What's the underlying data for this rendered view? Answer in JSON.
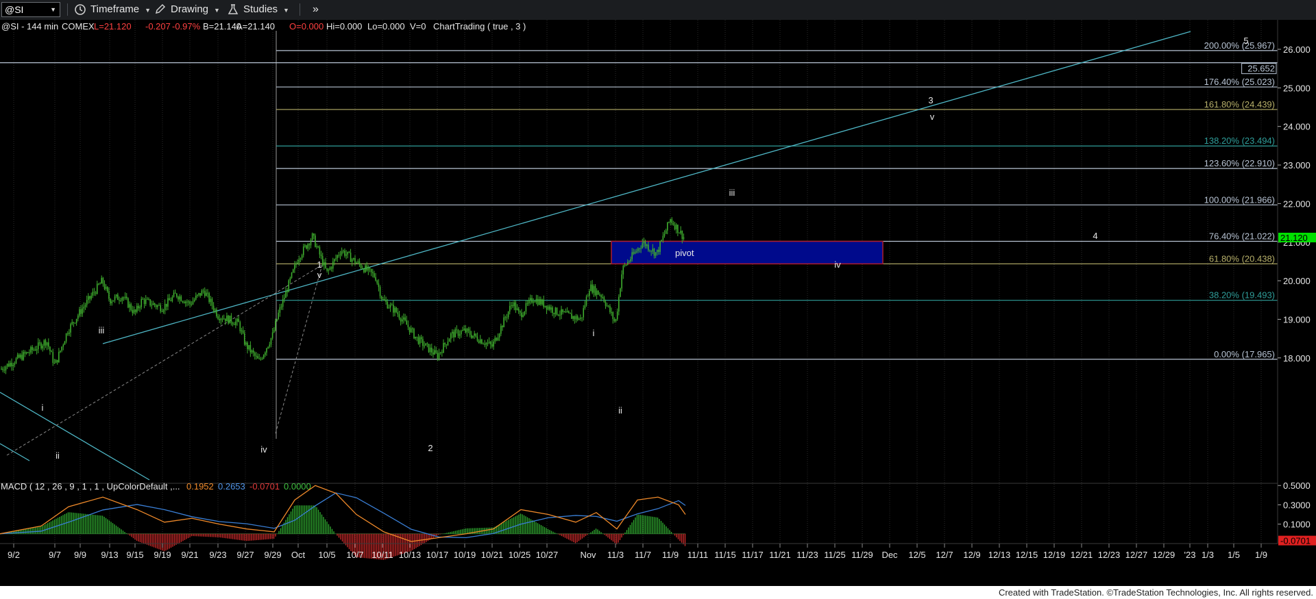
{
  "toolbar": {
    "symbol": "@SI",
    "timeframe_label": "Timeframe",
    "drawing_label": "Drawing",
    "studies_label": "Studies",
    "more_label": "»"
  },
  "info_line": {
    "symbol": "@SI - 144 min",
    "exchange": "COMEX",
    "last": "L=21.120",
    "change": "-0.207",
    "change_pct": "-0.97%",
    "bid": "B=21.140",
    "ask": "A=21.140",
    "open": "O=0.000",
    "hi": "Hi=0.000",
    "lo": "Lo=0.000",
    "volume": "V=0",
    "study": "ChartTrading ( true , 3 )"
  },
  "macd_line": {
    "label": "MACD ( 12 , 26 , 9 , 1 , 1 , UpColorDefault ,...",
    "macd": "0.1952",
    "signal": "0.2653",
    "diff": "-0.0701",
    "zero": "0.0000"
  },
  "footer": {
    "text": "Created with TradeStation. ©TradeStation Technologies, Inc. All rights reserved."
  },
  "colors": {
    "background": "#000000",
    "candle": "#3fae2e",
    "trendline": "#4fb8c7",
    "pivot_fill": "#000a8c",
    "pivot_border": "#b01c2c",
    "last_price": "#00e000",
    "macd_line": "#f08a2a",
    "signal_line": "#3a7fd6",
    "hist_pos": "#2fa62f",
    "hist_neg": "#c82a2a",
    "macd_neg_label": "#e02020"
  },
  "chart_data": {
    "type": "candlestick",
    "instrument": "@SI",
    "interval": "144 min",
    "ylim": [
      17.4,
      26.8
    ],
    "price_axis_ticks": [
      "26.000",
      "25.000",
      "24.000",
      "23.000",
      "22.000",
      "21.000",
      "20.000",
      "19.000",
      "18.000"
    ],
    "last_price": "21.120",
    "date_labels": [
      "9/2",
      "9/7",
      "9/9",
      "9/13",
      "9/15",
      "9/19",
      "9/21",
      "9/23",
      "9/27",
      "9/29",
      "Oct",
      "10/5",
      "10/7",
      "10/11",
      "10/13",
      "10/17",
      "10/19",
      "10/21",
      "10/25",
      "10/27",
      "Nov",
      "11/3",
      "11/7",
      "11/9",
      "11/11",
      "11/15",
      "11/17",
      "11/21",
      "11/23",
      "11/25",
      "11/29",
      "Dec",
      "12/5",
      "12/7",
      "12/9",
      "12/13",
      "12/15",
      "12/19",
      "12/21",
      "12/23",
      "12/27",
      "12/29",
      "'23",
      "1/3",
      "1/5",
      "1/9"
    ],
    "fib_levels": [
      {
        "label": "200.00% (25.967)",
        "price": 25.967,
        "color": "#b8c4d4"
      },
      {
        "label": "25.652",
        "price": 25.652,
        "color": "#b8c4d4",
        "boxed": true
      },
      {
        "label": "176.40% (25.023)",
        "price": 25.023,
        "color": "#b8c4d4"
      },
      {
        "label": "161.80% (24.439)",
        "price": 24.439,
        "color": "#b7b06a"
      },
      {
        "label": "138.20% (23.494)",
        "price": 23.494,
        "color": "#2f9e9a"
      },
      {
        "label": "123.60% (22.910)",
        "price": 22.91,
        "color": "#b8c4d4"
      },
      {
        "label": "100.00% (21.966)",
        "price": 21.966,
        "color": "#b8c4d4"
      },
      {
        "label": "76.40% (21.022)",
        "price": 21.022,
        "color": "#b8c4d4"
      },
      {
        "label": "61.80% (20.438)",
        "price": 20.438,
        "color": "#b7b06a"
      },
      {
        "label": "38.20% (19.493)",
        "price": 19.493,
        "color": "#2f9e9a"
      },
      {
        "label": "0.00% (17.965)",
        "price": 17.965,
        "color": "#b8c4d4"
      }
    ],
    "pivot_zone": {
      "label": "pivot",
      "low": 20.438,
      "high": 21.022
    },
    "wave_labels": [
      "5",
      "3",
      "v",
      "iii",
      "4",
      "iv",
      "1",
      "v",
      "iii",
      "i",
      "ii",
      "iv",
      "2",
      "i",
      "ii"
    ],
    "price_path": [
      {
        "d": "9/1",
        "p": 17.7
      },
      {
        "d": "9/5",
        "p": 18.3
      },
      {
        "d": "9/6",
        "p": 18.45
      },
      {
        "d": "9/7",
        "p": 17.8
      },
      {
        "d": "9/8",
        "p": 18.7
      },
      {
        "d": "9/9",
        "p": 19.2
      },
      {
        "d": "9/12",
        "p": 20.0
      },
      {
        "d": "9/13",
        "p": 19.5
      },
      {
        "d": "9/14",
        "p": 19.6
      },
      {
        "d": "9/15",
        "p": 19.15
      },
      {
        "d": "9/16",
        "p": 19.5
      },
      {
        "d": "9/19",
        "p": 19.3
      },
      {
        "d": "9/20",
        "p": 19.65
      },
      {
        "d": "9/21",
        "p": 19.4
      },
      {
        "d": "9/22",
        "p": 19.75
      },
      {
        "d": "9/23",
        "p": 19.1
      },
      {
        "d": "9/26",
        "p": 18.9
      },
      {
        "d": "9/27",
        "p": 18.35
      },
      {
        "d": "9/28",
        "p": 17.9
      },
      {
        "d": "9/29",
        "p": 18.6
      },
      {
        "d": "9/30",
        "p": 19.1
      },
      {
        "d": "10/3",
        "p": 20.6
      },
      {
        "d": "10/4",
        "p": 21.15
      },
      {
        "d": "10/5",
        "p": 20.2
      },
      {
        "d": "10/6",
        "p": 20.8
      },
      {
        "d": "10/7",
        "p": 20.5
      },
      {
        "d": "10/10",
        "p": 20.1
      },
      {
        "d": "10/11",
        "p": 19.5
      },
      {
        "d": "10/12",
        "p": 19.2
      },
      {
        "d": "10/13",
        "p": 18.75
      },
      {
        "d": "10/14",
        "p": 18.5
      },
      {
        "d": "10/17",
        "p": 18.05
      },
      {
        "d": "10/18",
        "p": 18.6
      },
      {
        "d": "10/19",
        "p": 18.7
      },
      {
        "d": "10/20",
        "p": 18.5
      },
      {
        "d": "10/21",
        "p": 18.3
      },
      {
        "d": "10/24",
        "p": 19.45
      },
      {
        "d": "10/25",
        "p": 19.1
      },
      {
        "d": "10/26",
        "p": 19.55
      },
      {
        "d": "10/27",
        "p": 19.35
      },
      {
        "d": "10/28",
        "p": 19.2
      },
      {
        "d": "10/31",
        "p": 19.0
      },
      {
        "d": "11/1",
        "p": 19.85
      },
      {
        "d": "11/2",
        "p": 19.6
      },
      {
        "d": "11/3",
        "p": 18.9
      },
      {
        "d": "11/4",
        "p": 20.3
      },
      {
        "d": "11/7",
        "p": 21.0
      },
      {
        "d": "11/8",
        "p": 20.7
      },
      {
        "d": "11/9",
        "p": 21.6
      },
      {
        "d": "11/10",
        "p": 21.12
      }
    ],
    "macd_ticks": [
      "0.5000",
      "0.3000",
      "0.1000",
      "-0.0701"
    ]
  }
}
